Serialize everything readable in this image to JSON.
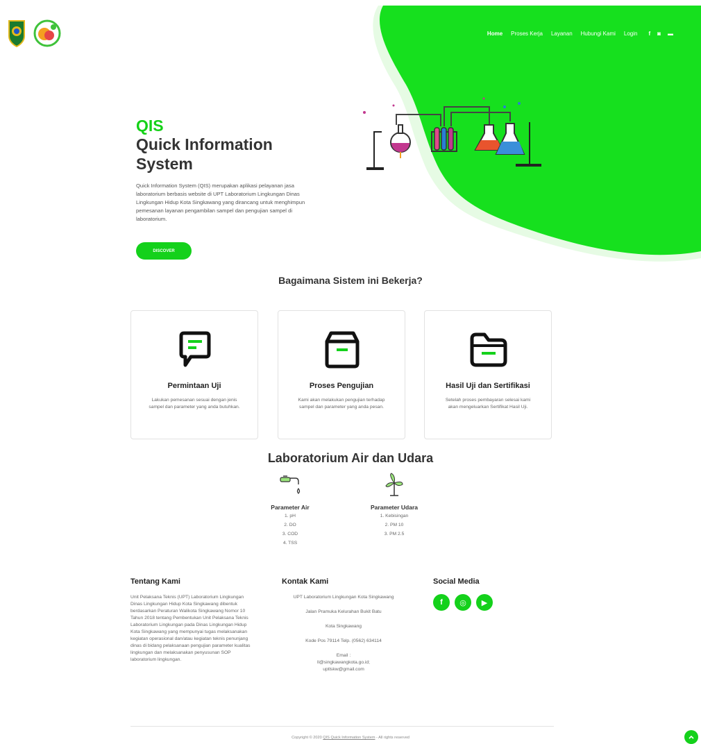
{
  "nav": {
    "items": [
      "Home",
      "Proses Kerja",
      "Layanan",
      "Hubungi Kami",
      "Login"
    ],
    "social_icons": [
      "facebook-icon",
      "instagram-icon",
      "youtube-icon"
    ]
  },
  "hero": {
    "title_accent": "QIS",
    "title_line1": "Quick Information",
    "title_line2": "System",
    "description": "Quick Information System (QIS) merupakan aplikasi pelayanan jasa laboratorium berbasis website di UPT Laboratorium Lingkungan Dinas Lingkungan Hidup Kota Singkawang yang dirancang untuk menghimpun pemesanan layanan pengambilan sampel dan pengujian sampel di laboratorium.",
    "button_label": "DISCOVER"
  },
  "process": {
    "title": "Bagaimana Sistem ini Bekerja?",
    "cards": [
      {
        "title": "Permintaan Uji",
        "text": "Lakukan pemesanan sesuai dengan jenis sampel dan parameter yang anda butuhkan.",
        "icon": "chat-message-icon"
      },
      {
        "title": "Proses Pengujian",
        "text": "Kami akan melakukan pengujian terhadap sampel dan parameter yang anda pesan.",
        "icon": "box-icon"
      },
      {
        "title": "Hasil Uji dan Sertifikasi",
        "text": "Setelah proses pembayaran selesai kami akan mengeluarkan Sertifikat Hasil Uji.",
        "icon": "folder-icon"
      }
    ]
  },
  "lab": {
    "title": "Laboratorium Air dan Udara",
    "air": {
      "title": "Parameter Air",
      "items": [
        "1. pH",
        "2. DO",
        "3. COD",
        "4. TSS"
      ],
      "icon": "water-tap-icon"
    },
    "udara": {
      "title": "Parameter Udara",
      "items": [
        "1. Kebisingan",
        "2. PM 10",
        "3. PM 2.5"
      ],
      "icon": "wind-turbine-icon"
    }
  },
  "footer": {
    "about_title": "Tentang Kami",
    "about_text": "Unit Pelaksana Teknis (UPT) Laboratorium Lingkungan Dinas Lingkungan Hidup Kota Singkawang dibentuk berdasarkan Peraturan Walikota Singkawang Nomor 10 Tahun 2018 tentang Pembentukan Unit Pelaksana Teknis Laboratorium Lingkungan pada Dinas Lingkungan Hidup Kota Singkawang yang mempunyai tugas melaksanakan kegiatan operasional dan/atau kegiatan teknis penunjang dinas di bidang pelaksanaan pengujian parameter kualitas lingkungan dan melaksanakan penyusunan SOP laboratorium lingkungan.",
    "contact_title": "Kontak Kami",
    "contact_lines": [
      "UPT Laboratorium Lingkungan Kota Singkawang",
      "Jalan Pramuka Kelurahan Bukit Batu",
      "Kota Singkawang",
      "Kode Pos 79114 Telp. (0562) 634114",
      "Email : ll@singkawangkota.go.id; uptlskw@gmail.com"
    ],
    "social_title": "Social Media",
    "social_icons": [
      "facebook-icon",
      "instagram-icon",
      "youtube-icon"
    ],
    "copyright_prefix": "Copyright © 2020 ",
    "copyright_link": "QIS Quick Information System",
    "copyright_suffix": " - All rights reserved"
  },
  "colors": {
    "accent": "#14d11b",
    "text": "#333333"
  }
}
